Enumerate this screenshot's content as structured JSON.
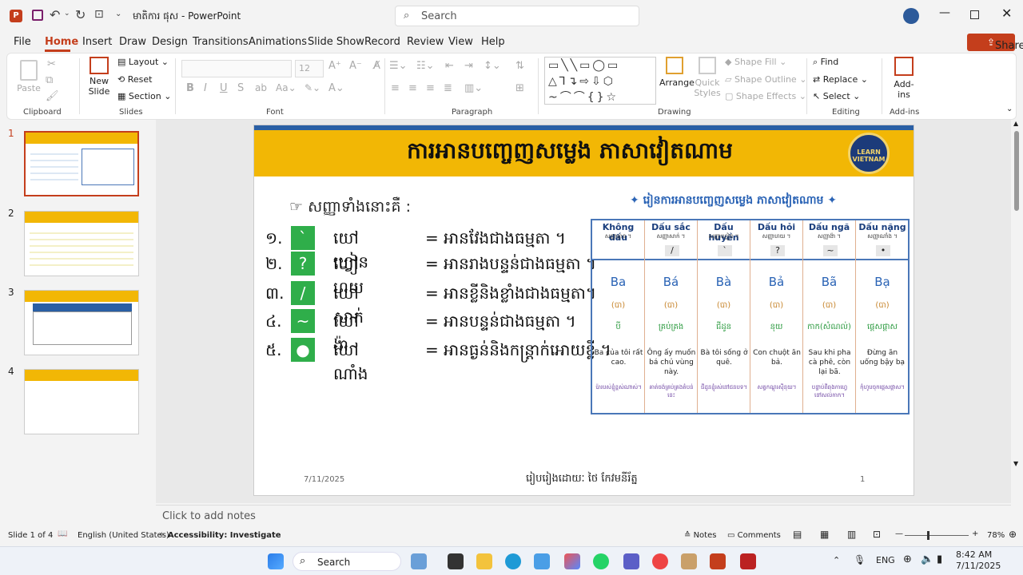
{
  "window": {
    "doc_title": "មាតិការ ផុស",
    "app": "PowerPoint",
    "search_placeholder": "Search"
  },
  "menu": [
    "File",
    "Home",
    "Insert",
    "Draw",
    "Design",
    "Transitions",
    "Animations",
    "Slide Show",
    "Record",
    "Review",
    "View",
    "Help"
  ],
  "share_label": "Share",
  "ribbon": {
    "clipboard": {
      "label": "Clipboard",
      "paste": "Paste"
    },
    "slides": {
      "label": "Slides",
      "new_slide": "New",
      "new_slide2": "Slide",
      "layout": "Layout",
      "reset": "Reset",
      "section": "Section"
    },
    "font": {
      "label": "Font",
      "size": "12"
    },
    "paragraph": {
      "label": "Paragraph"
    },
    "drawing": {
      "label": "Drawing",
      "arrange": "Arrange",
      "quick": "Quick",
      "styles": "Styles",
      "fill": "Shape Fill",
      "outline": "Shape Outline",
      "effects": "Shape Effects"
    },
    "editing": {
      "label": "Editing",
      "find": "Find",
      "replace": "Replace",
      "select": "Select"
    },
    "addins": {
      "label": "Add-ins",
      "btn": "Add-ins"
    }
  },
  "thumbnails": [
    "1",
    "2",
    "3",
    "4"
  ],
  "slide": {
    "title": "ការអានបញ្ចេញសម្លេង ភាសាវៀតណាម",
    "logo": "LEARN VIETNAM",
    "intro": "☞ សញ្ញាទាំងនោះគឺ :",
    "rows": [
      {
        "num": "១.",
        "mark": "`",
        "name": "យៅ ហ្វៀន",
        "desc": "= អានវែងជាងធម្មតា ។"
      },
      {
        "num": "២.",
        "mark": "?",
        "name": "យៅ ហយ",
        "desc": "= អានរាងបន្ទន់ជាងធម្មតា ។"
      },
      {
        "num": "៣.",
        "mark": "/",
        "name": "យៅ សាក់",
        "desc": "= អានខ្លីនិងខ្លាំងជាងធម្មតា។"
      },
      {
        "num": "៤.",
        "mark": "~",
        "name": "យៅ ង៉ា",
        "desc": "= អានបន្ទន់ជាងធម្មតា ។"
      },
      {
        "num": "៥.",
        "mark": "●",
        "name": "យៅ ណាំង",
        "desc": "= អានធ្ងន់និងកន្ត្រាក់អោយខ្លី ។"
      }
    ],
    "table_title": "✦ រៀនការអានបញ្ចេញសម្លេង ភាសាវៀតណាម ✦",
    "cols": [
      {
        "h1": "Không dấu",
        "h2": "សញ្ញាគ្មាន ។",
        "mark": "",
        "big": "Ba",
        "pr": "(បា)",
        "kh": "បី",
        "sen": "Ba của tôi rất cao.",
        "tr": "ប៉ារបស់ខ្ញុំខ្ពស់ណាស់។"
      },
      {
        "h1": "Dấu sắc",
        "h2": "សញ្ញាសាក់ ។",
        "mark": "/",
        "big": "Bá",
        "pr": "(បា)",
        "kh": "គ្រប់គ្រង",
        "sen": "Ông ấy muốn bá chủ vùng này.",
        "tr": "គាត់ចង់គ្រប់គ្រងតំបន់នេះ"
      },
      {
        "h1": "Dấu huyền",
        "h2": "សញ្ញាហ្វៀន ។",
        "mark": "`",
        "big": "Bà",
        "pr": "(បា)",
        "kh": "ជីដូន",
        "sen": "Bà tôi sống ở quê.",
        "tr": "ជីដូនខ្ញុំរស់នៅជនបទ។"
      },
      {
        "h1": "Dấu hỏi",
        "h2": "សញ្ញាហយ ។",
        "mark": "?",
        "big": "Bả",
        "pr": "(បា)",
        "kh": "នុយ",
        "sen": "Con chuột ăn bả.",
        "tr": "សត្វកណ្ដុរស៊ីនុយ។"
      },
      {
        "h1": "Dấu ngã",
        "h2": "សញ្ញាង៉ា ។",
        "mark": "~",
        "big": "Bã",
        "pr": "(បា)",
        "kh": "កាក(សំណល់)",
        "sen": "Sau khi pha cà phê, còn lại bã.",
        "tr": "បន្ទាប់ពីឆុងកាហ្វេ នៅសល់កាក។"
      },
      {
        "h1": "Dấu nặng",
        "h2": "សញ្ញាណាំង ។",
        "mark": "•",
        "big": "Bạ",
        "pr": "(បា)",
        "kh": "ផ្ដេសផ្ដាស",
        "sen": "Đừng ăn uống bậy bạ",
        "tr": "កុំហូបចុកផ្ដេសផ្ដាស។"
      }
    ],
    "footer_date": "7/11/2025",
    "footer_text": "រៀបរៀងដោយៈ ថៃ កែវមនីរ័ត្ន",
    "footer_num": "1"
  },
  "notes_placeholder": "Click to add notes",
  "status": {
    "slide": "Slide 1 of 4",
    "lang": "English (United States)",
    "access": "Accessibility: Investigate",
    "notes": "Notes",
    "comments": "Comments",
    "zoom": "78%"
  },
  "taskbar": {
    "search": "Search",
    "lang": "ENG",
    "time": "8:42 AM",
    "date": "7/11/2025"
  }
}
